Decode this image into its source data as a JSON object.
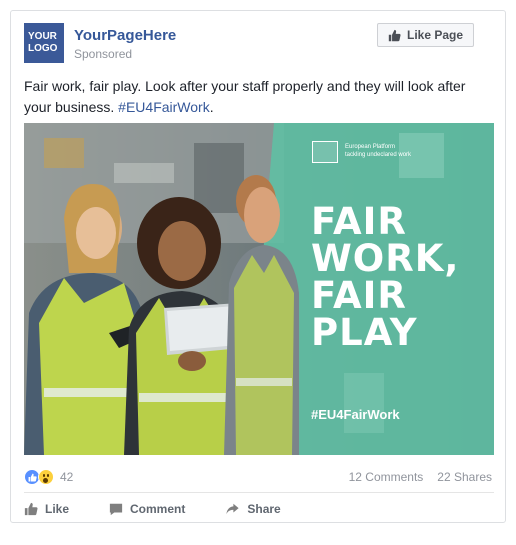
{
  "page": {
    "logo_line1": "YOUR",
    "logo_line2": "LOGO",
    "name": "YourPageHere",
    "sponsored": "Sponsored",
    "like_page_label": "Like Page"
  },
  "post": {
    "text": "Fair work, fair play. Look after your staff properly and they will look after your business.",
    "hashtag": "#EU4FairWork",
    "hashtag_suffix": "."
  },
  "ad": {
    "headline_lines": [
      "FAIR",
      "WORK,",
      "FAIR",
      "PLAY"
    ],
    "hashtag": "#EU4FairWork",
    "partner_line1": "European Platform",
    "partner_line2": "tackling undeclared work",
    "overlay_color": "#5fc0a4"
  },
  "engagement": {
    "reaction_count": "42",
    "comments": "12 Comments",
    "shares": "22 Shares"
  },
  "actions": {
    "like": "Like",
    "comment": "Comment",
    "share": "Share"
  },
  "icons": [
    "thumbs-up-icon",
    "wow-reaction-icon",
    "comment-icon",
    "share-icon"
  ]
}
